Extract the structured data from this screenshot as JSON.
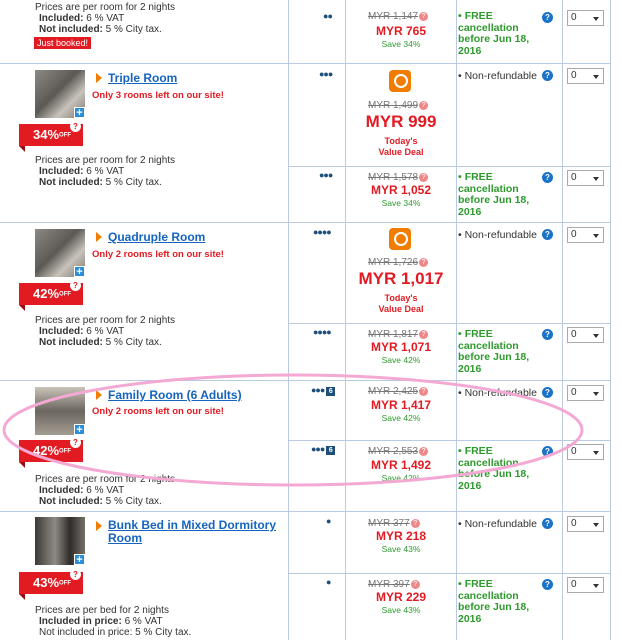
{
  "policy": {
    "per_room": "Prices are per room for 2 nights",
    "included": "Included:",
    "vat": "6 % VAT",
    "not_included": "Not included:",
    "city_tax": "5 % City tax.",
    "per_bed": "Prices are per bed for 2 nights",
    "included_price": "Included in price:",
    "not_included_price": "Not included in price:",
    "city_tax2": "5 % City tax."
  },
  "badges": {
    "just_booked": "Just booked!",
    "off": "OFF",
    "q": "?"
  },
  "rooms": [
    {
      "name": "Triple Room",
      "left": "Only 3 rooms left on our site!",
      "discount": "34%"
    },
    {
      "name": "Quadruple Room",
      "left": "Only 2 rooms left on our site!",
      "discount": "42%"
    },
    {
      "name": "Family Room (6 Adults)",
      "left": "Only 2 rooms left on our site!",
      "discount": "42%"
    },
    {
      "name": "Bunk Bed in Mixed Dormitory Room",
      "left": "",
      "discount": "43%"
    }
  ],
  "offers": [
    {
      "old": "MYR 1,147",
      "new": "MYR 765",
      "save": "Save 34%"
    },
    {
      "old": "MYR 1,499",
      "new": "MYR 999",
      "deal": "Today's Value Deal"
    },
    {
      "old": "MYR 1,578",
      "new": "MYR 1,052",
      "save": "Save 34%"
    },
    {
      "old": "MYR 1,726",
      "new": "MYR 1,017",
      "deal": "Today's Value Deal"
    },
    {
      "old": "MYR 1,817",
      "new": "MYR 1,071",
      "save": "Save 42%"
    },
    {
      "old": "MYR 2,425",
      "new": "MYR 1,417",
      "save": "Save 42%"
    },
    {
      "old": "MYR 2,553",
      "new": "MYR 1,492",
      "save": "Save 42%"
    },
    {
      "old": "MYR 377",
      "new": "MYR 218",
      "save": "Save 43%"
    },
    {
      "old": "MYR 397",
      "new": "MYR 229",
      "save": "Save 43%"
    }
  ],
  "conditions": {
    "free": "FREE cancellation before Jun 18, 2016",
    "nonref": "Non-refundable",
    "qty": "0"
  },
  "occupancy": {
    "one": "●",
    "three": "●●●",
    "four": "●●●●",
    "six": "6"
  },
  "colors": {
    "price_red": "#e21b23",
    "save_green": "#2e9a2e",
    "link_blue": "#1565c0",
    "grid": "#b9cbe2",
    "highlight_ellipse": "#f3a9d3"
  }
}
